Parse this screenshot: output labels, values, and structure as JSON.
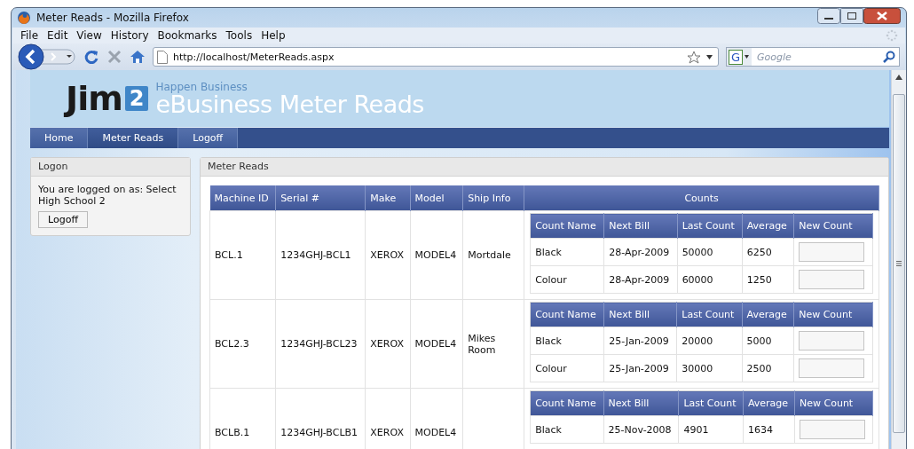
{
  "window": {
    "title": "Meter Reads - Mozilla Firefox"
  },
  "menu": [
    {
      "label": "File"
    },
    {
      "label": "Edit"
    },
    {
      "label": "View"
    },
    {
      "label": "History"
    },
    {
      "label": "Bookmarks"
    },
    {
      "label": "Tools"
    },
    {
      "label": "Help"
    }
  ],
  "address": {
    "url": "http://localhost/MeterReads.aspx"
  },
  "search": {
    "engine_label": "G",
    "placeholder": "Google"
  },
  "header": {
    "logo_text": "Jim",
    "logo_number": "2",
    "tagline": "Happen Business",
    "title": "eBusiness Meter Reads"
  },
  "nav": [
    {
      "label": "Home",
      "selected": false
    },
    {
      "label": "Meter Reads",
      "selected": true
    },
    {
      "label": "Logoff",
      "selected": false
    }
  ],
  "logon": {
    "title": "Logon",
    "message": "You are logged on as: Select High School 2",
    "button": "Logoff"
  },
  "meter_reads": {
    "title": "Meter Reads",
    "columns": [
      "Machine ID",
      "Serial #",
      "Make",
      "Model",
      "Ship Info",
      "Counts"
    ],
    "rows": [
      {
        "machine_id": "BCL.1",
        "serial": "1234GHJ-BCL1",
        "make": "XEROX",
        "model": "MODEL4",
        "ship_info": "Mortdale",
        "count_columns": [
          "Count Name",
          "Next Bill",
          "Last Count",
          "Average",
          "New Count"
        ],
        "counts": [
          {
            "name": "Black",
            "next_bill": "28-Apr-2009",
            "last_count": "50000",
            "average": "6250"
          },
          {
            "name": "Colour",
            "next_bill": "28-Apr-2009",
            "last_count": "60000",
            "average": "1250"
          }
        ]
      },
      {
        "machine_id": "BCL2.3",
        "serial": "1234GHJ-BCL23",
        "make": "XEROX",
        "model": "MODEL4",
        "ship_info": "Mikes Room",
        "count_columns": [
          "Count Name",
          "Next Bill",
          "Last Count",
          "Average",
          "New Count"
        ],
        "counts": [
          {
            "name": "Black",
            "next_bill": "25-Jan-2009",
            "last_count": "20000",
            "average": "5000"
          },
          {
            "name": "Colour",
            "next_bill": "25-Jan-2009",
            "last_count": "30000",
            "average": "2500"
          }
        ]
      },
      {
        "machine_id": "BCLB.1",
        "serial": "1234GHJ-BCLB1",
        "make": "XEROX",
        "model": "MODEL4",
        "count_columns": [
          "Count Name",
          "Next Bill",
          "Last Count",
          "Average",
          "New Count"
        ],
        "counts": [
          {
            "name": "Black",
            "next_bill": "25-Nov-2008",
            "last_count": "4901",
            "average": "1634"
          }
        ]
      }
    ]
  }
}
